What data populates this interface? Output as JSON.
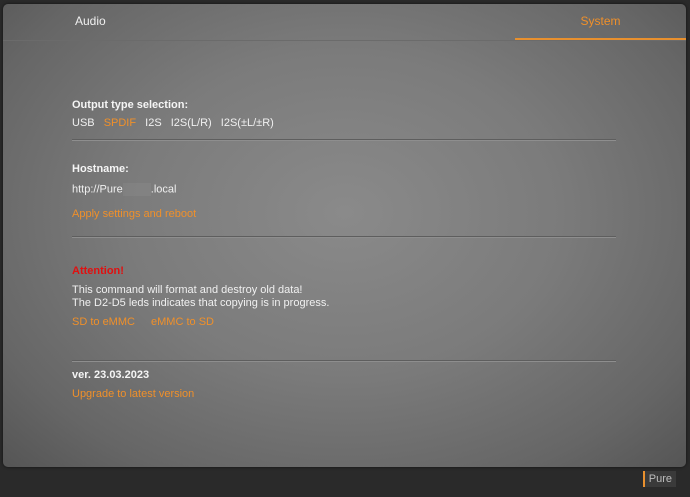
{
  "tabs": {
    "audio": "Audio",
    "system": "System"
  },
  "output": {
    "heading": "Output type selection:",
    "options": [
      "USB",
      "SPDIF",
      "I2S",
      "I2S(L/R)",
      "I2S(±L/±R)"
    ],
    "selected": "SPDIF"
  },
  "hostname": {
    "heading": "Hostname:",
    "prefix": "http://",
    "value": "Pure",
    "suffix": ".local",
    "apply_label": "Apply settings and reboot"
  },
  "copy": {
    "attention": "Attention!",
    "line1": "This command will format and destroy old data!",
    "line2": "The D2-D5 leds indicates that copying is in progress.",
    "sd_to_emmc": "SD to eMMC",
    "emmc_to_sd": "eMMC to SD"
  },
  "version": {
    "label": "ver. 23.03.2023",
    "upgrade_label": "Upgrade to latest version"
  },
  "status": {
    "device_name": "Pure"
  },
  "colors": {
    "accent": "#f0902a",
    "warning": "#e01010"
  }
}
